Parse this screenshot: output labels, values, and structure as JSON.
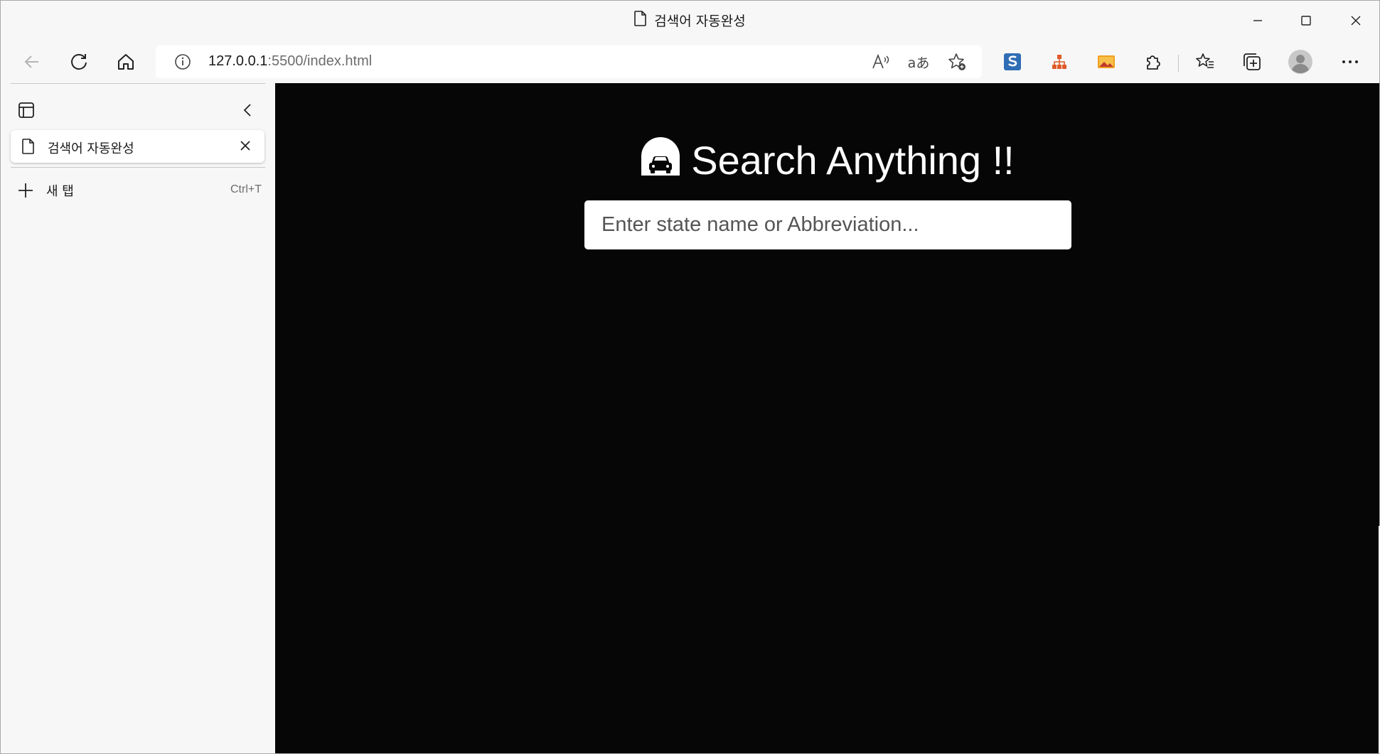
{
  "window": {
    "title": "검색어 자동완성"
  },
  "toolbar": {
    "url_host": "127.0.0.1",
    "url_rest": ":5500/index.html"
  },
  "sidepanel": {
    "tabs": [
      {
        "label": "검색어 자동완성"
      }
    ],
    "new_tab_label": "새 탭",
    "new_tab_shortcut": "Ctrl+T"
  },
  "page": {
    "heading": "Search Anything !!",
    "search_placeholder": "Enter state name or Abbreviation...",
    "search_value": ""
  },
  "colors": {
    "page_background": "#060606",
    "chrome_background": "#f7f7f7",
    "heading_color": "#ffffff"
  }
}
